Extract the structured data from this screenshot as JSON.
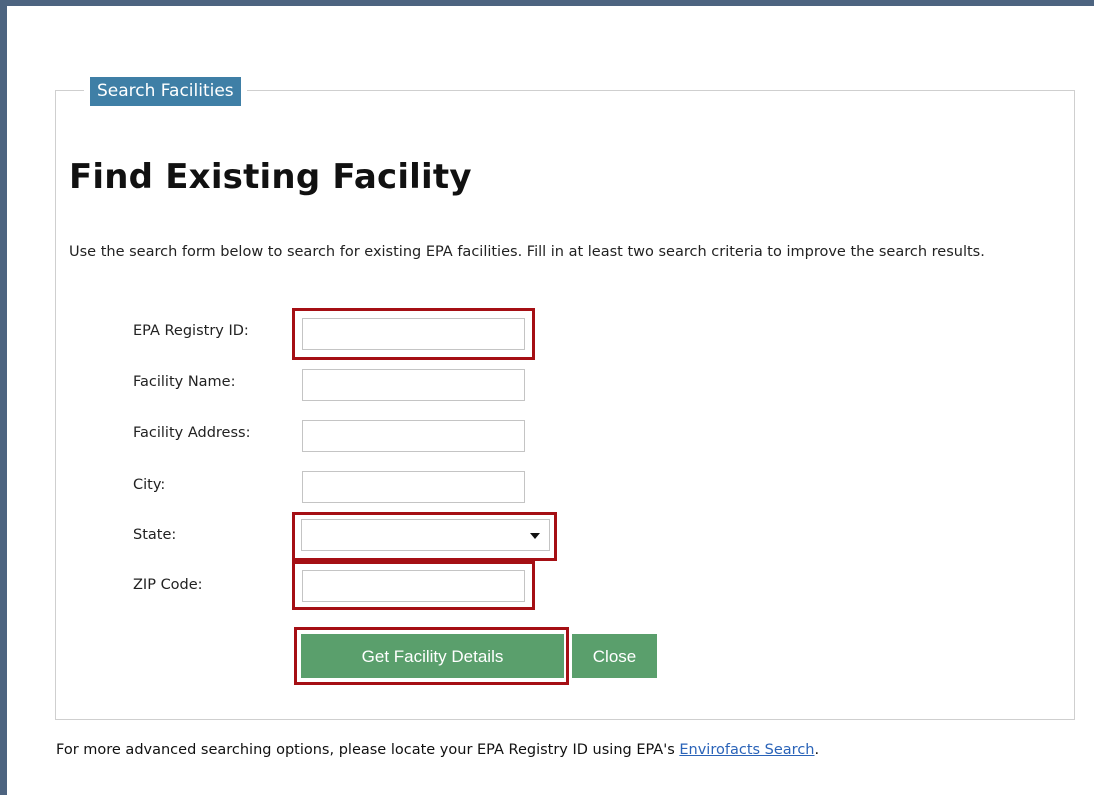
{
  "legend": "Search Facilities",
  "title": "Find Existing Facility",
  "intro": "Use the search form below to search for existing EPA facilities. Fill in at least two search criteria to improve the search results.",
  "fields": {
    "registry_id": {
      "label": "EPA Registry ID:",
      "value": ""
    },
    "facility_name": {
      "label": "Facility Name:",
      "value": ""
    },
    "facility_address": {
      "label": "Facility Address:",
      "value": ""
    },
    "city": {
      "label": "City:",
      "value": ""
    },
    "state": {
      "label": "State:",
      "value": ""
    },
    "zip": {
      "label": "ZIP Code:",
      "value": ""
    }
  },
  "buttons": {
    "get_details": "Get Facility Details",
    "close": "Close"
  },
  "footer": {
    "text": "For more advanced searching options, please locate your EPA Registry ID using EPA's ",
    "link": "Envirofacts Search",
    "end": "."
  },
  "colors": {
    "frame": "#4d6480",
    "legend_bg": "#3f7fa6",
    "button_bg": "#5a9f6c",
    "highlight": "#a50f14",
    "link": "#2a63b8"
  }
}
